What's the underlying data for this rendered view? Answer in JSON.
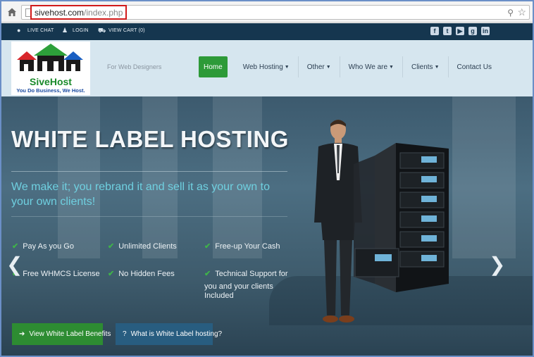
{
  "browser": {
    "url_host": "sivehost.com",
    "url_path": "/index.php"
  },
  "top_strip": {
    "live_chat": "LIVE CHAT",
    "login": "LOGIN",
    "view_cart": "VIEW CART (0)",
    "social_icons": [
      "facebook-icon",
      "twitter-icon",
      "youtube-icon",
      "google-plus-icon",
      "linkedin-icon"
    ]
  },
  "header": {
    "logo_title": "SiveHost",
    "logo_tagline": "You Do Business, We Host.",
    "tagline": "For Web Designers",
    "nav": [
      {
        "label": "Home",
        "active": true,
        "dropdown": false
      },
      {
        "label": "Web Hosting",
        "active": false,
        "dropdown": true
      },
      {
        "label": "Other",
        "active": false,
        "dropdown": true
      },
      {
        "label": "Who We are",
        "active": false,
        "dropdown": true
      },
      {
        "label": "Clients",
        "active": false,
        "dropdown": true
      },
      {
        "label": "Contact Us",
        "active": false,
        "dropdown": false
      }
    ]
  },
  "hero": {
    "title": "WHITE LABEL HOSTING",
    "subtitle": "We make it; you rebrand it and sell it as your own to your own clients!",
    "features": [
      "Pay As you Go",
      "Unlimited Clients",
      "Free-up Your Cash",
      "Free WHMCS License",
      "No Hidden Fees",
      "Technical Support for"
    ],
    "feature_extra": "you and your clients Included",
    "button_benefits": "View White Label Benefits",
    "button_what": "What is White Label hosting?",
    "prev_arrow": "❮",
    "next_arrow": "❯"
  },
  "colors": {
    "nav_active": "#2d9a38",
    "top_strip": "#15364f",
    "subtitle": "#6fd0e0",
    "check": "#3fb24a"
  }
}
